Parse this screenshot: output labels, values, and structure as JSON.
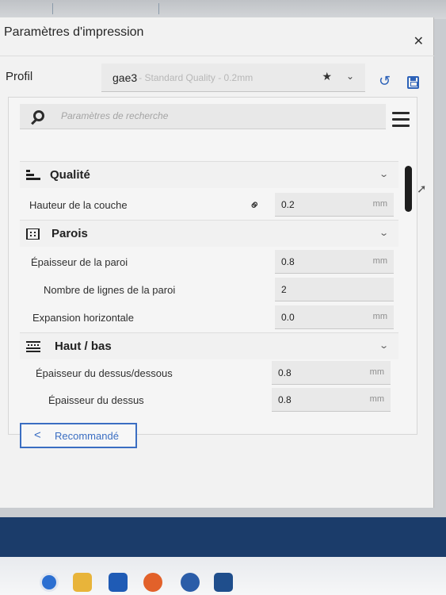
{
  "dialog": {
    "title": "Paramètres d'impression",
    "close_glyph": "✕"
  },
  "profile": {
    "label": "Profil",
    "name": "gae3",
    "description": "- Standard Quality - 0.2mm",
    "star_glyph": "★",
    "chevron_glyph": "⌄",
    "reset_glyph": "↺"
  },
  "search": {
    "placeholder": "Paramètres de recherche"
  },
  "sections": {
    "qualite": {
      "title": "Qualité",
      "chevron": "⌄"
    },
    "parois": {
      "title": "Parois",
      "chevron": "⌄"
    },
    "haut_bas": {
      "title": "Haut / bas",
      "chevron": "⌄"
    }
  },
  "settings": {
    "hauteur_couche": {
      "label": "Hauteur de la couche",
      "value": "0.2",
      "unit": "mm"
    },
    "epaisseur_paroi": {
      "label": "Épaisseur de la paroi",
      "value": "0.8",
      "unit": "mm"
    },
    "nombre_lignes": {
      "label": "Nombre de lignes de la paroi",
      "value": "2",
      "unit": ""
    },
    "expansion": {
      "label": "Expansion horizontale",
      "value": "0.0",
      "unit": "mm"
    },
    "epaisseur_dessus_dessous": {
      "label": "Épaisseur du dessus/dessous",
      "value": "0.8",
      "unit": "mm"
    },
    "epaisseur_dessus": {
      "label": "Épaisseur du dessus",
      "value": "0.8",
      "unit": "mm"
    }
  },
  "recommended": {
    "label": "Recommandé",
    "chevron": "<"
  },
  "taskbar": {
    "icons": [
      "edge-icon",
      "folder-icon",
      "media-icon",
      "firefox-icon",
      "app-icon",
      "cura-icon"
    ]
  },
  "colors": {
    "accent": "#2d62b8",
    "taskbar_band": "#1b3c6a"
  }
}
